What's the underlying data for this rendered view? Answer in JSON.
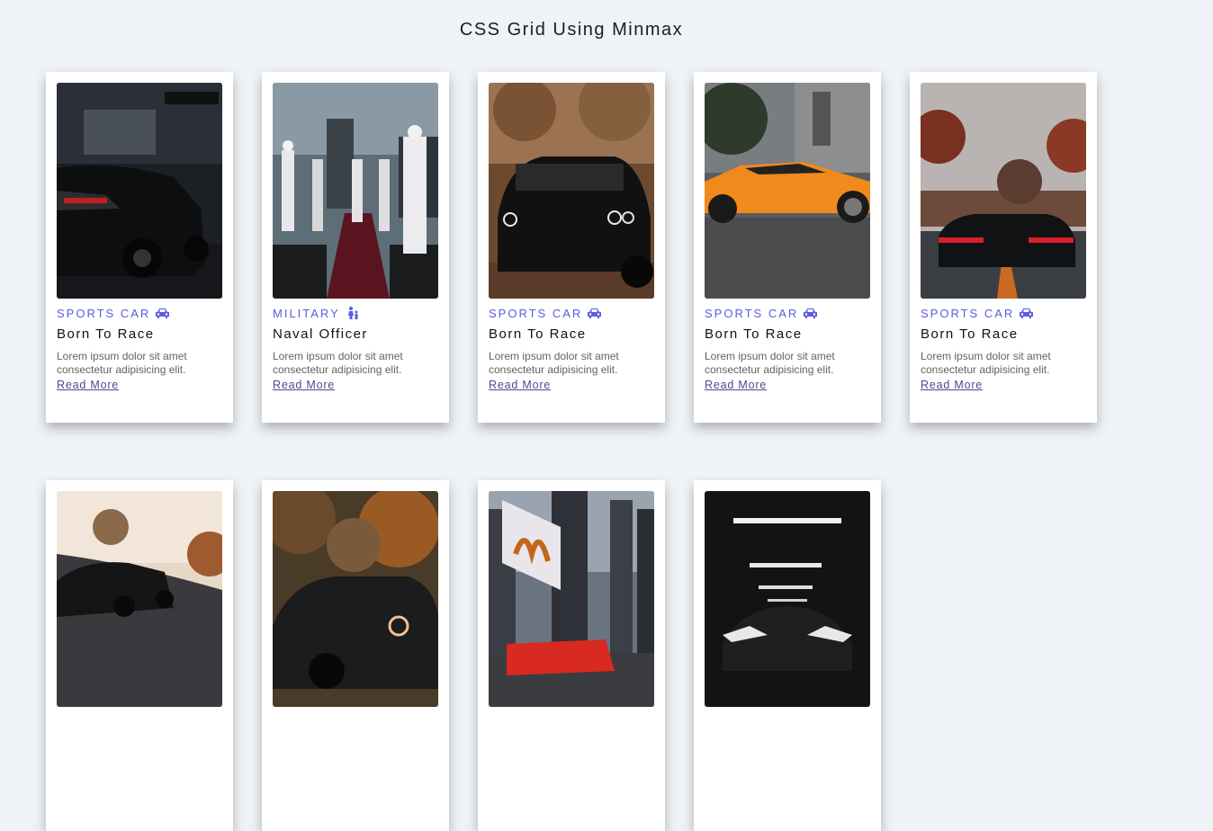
{
  "page": {
    "title": "CSS Grid Using Minmax"
  },
  "colors": {
    "background": "#eff2f7",
    "accent": "#5b5ce0",
    "link": "#4a4a88"
  },
  "cards": [
    {
      "category": "SPORTS CAR",
      "category_icon": "car-icon",
      "title": "Born To Race",
      "description": "Lorem ipsum dolor sit amet consectetur adipisicing elit.",
      "link": "Read More",
      "image": "black sports car rear view in rain"
    },
    {
      "category": "MILITARY",
      "category_icon": "person-with-child-icon",
      "title": "Naval Officer",
      "description": "Lorem ipsum dolor sit amet consectetur adipisicing elit.",
      "link": "Read More",
      "image": "naval officers saluting on red carpet"
    },
    {
      "category": "SPORTS CAR",
      "category_icon": "car-icon",
      "title": "Born To Race",
      "description": "Lorem ipsum dolor sit amet consectetur adipisicing elit.",
      "link": "Read More",
      "image": "black muscle car front in autumn street"
    },
    {
      "category": "SPORTS CAR",
      "category_icon": "car-icon",
      "title": "Born To Race",
      "description": "Lorem ipsum dolor sit amet consectetur adipisicing elit.",
      "link": "Read More",
      "image": "orange supercar side view"
    },
    {
      "category": "SPORTS CAR",
      "category_icon": "car-icon",
      "title": "Born To Race",
      "description": "Lorem ipsum dolor sit amet consectetur adipisicing elit.",
      "link": "Read More",
      "image": "black car on autumn road"
    },
    {
      "image": "black sports car on sunset road"
    },
    {
      "image": "black muscle car in autumn forest"
    },
    {
      "image": "red car in city street with billboard"
    },
    {
      "image": "black car in dark garage"
    }
  ]
}
